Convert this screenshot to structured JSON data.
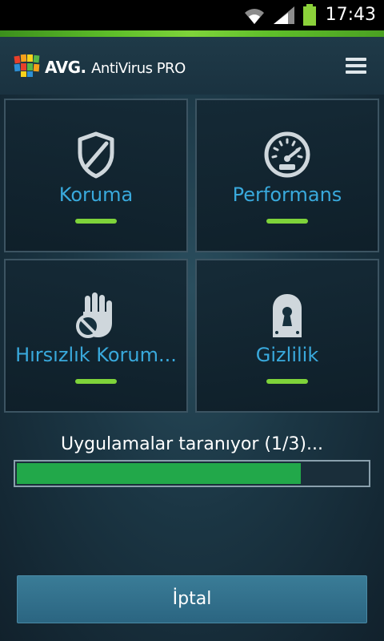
{
  "status_bar": {
    "time": "17:43",
    "icons": [
      "wifi-icon",
      "signal-icon",
      "battery-icon"
    ],
    "battery_color": "#8bd13a"
  },
  "header": {
    "brand": "AVG.",
    "product": "AntiVirus PRO",
    "menu_icon": "hamburger-menu-icon"
  },
  "tiles": [
    {
      "label": "Koruma",
      "icon": "shield-icon",
      "status_color": "#7ed33a"
    },
    {
      "label": "Performans",
      "icon": "speedometer-icon",
      "status_color": "#7ed33a"
    },
    {
      "label": "Hırsızlık Korum...",
      "icon": "stop-hand-icon",
      "status_color": "#7ed33a"
    },
    {
      "label": "Gizlilik",
      "icon": "keyhole-lock-icon",
      "status_color": "#7ed33a"
    }
  ],
  "scan": {
    "text": "Uygulamalar taranıyor (1/3)...",
    "progress_percent": 81
  },
  "cancel_label": "İptal",
  "colors": {
    "accent_blue": "#39a9dc",
    "accent_green": "#7ed33a",
    "progress_fill": "#22a84a",
    "button": "#2f6d89"
  }
}
